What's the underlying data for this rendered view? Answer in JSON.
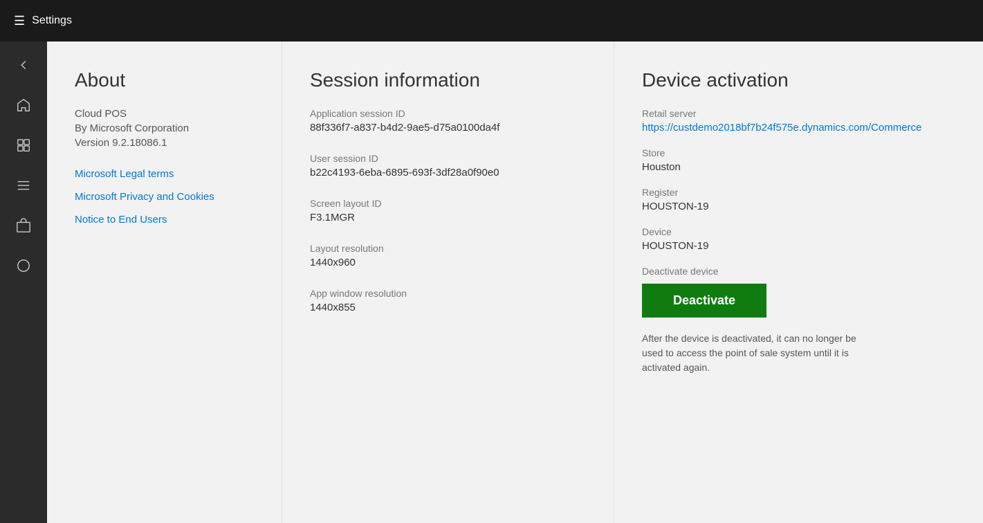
{
  "titlebar": {
    "title": "Settings"
  },
  "sidebar": {
    "items": [
      {
        "name": "back-button",
        "icon": "back"
      },
      {
        "name": "home-button",
        "icon": "home"
      },
      {
        "name": "box-button",
        "icon": "box"
      },
      {
        "name": "menu-button",
        "icon": "menu-lines"
      },
      {
        "name": "bag-button",
        "icon": "bag"
      },
      {
        "name": "circle-button",
        "icon": "circle"
      }
    ]
  },
  "about": {
    "title": "About",
    "app_name": "Cloud POS",
    "company": "By Microsoft Corporation",
    "version": "Version 9.2.18086.1",
    "links": [
      {
        "label": "Microsoft Legal terms"
      },
      {
        "label": "Microsoft Privacy and Cookies"
      },
      {
        "label": "Notice to End Users"
      }
    ]
  },
  "session": {
    "title": "Session information",
    "fields": [
      {
        "label": "Application session ID",
        "value": "88f336f7-a837-b4d2-9ae5-d75a0100da4f"
      },
      {
        "label": "User session ID",
        "value": "b22c4193-6eba-6895-693f-3df28a0f90e0"
      },
      {
        "label": "Screen layout ID",
        "value": "F3.1MGR"
      },
      {
        "label": "Layout resolution",
        "value": "1440x960"
      },
      {
        "label": "App window resolution",
        "value": "1440x855"
      }
    ]
  },
  "device_activation": {
    "title": "Device activation",
    "retail_server_label": "Retail server",
    "retail_server_url": "https://custdemo2018bf7b24f575e.dynamics.com/Commerce",
    "store_label": "Store",
    "store_value": "Houston",
    "register_label": "Register",
    "register_value": "HOUSTON-19",
    "device_label": "Device",
    "device_value": "HOUSTON-19",
    "deactivate_device_label": "Deactivate device",
    "deactivate_button_label": "Deactivate",
    "deactivate_note": "After the device is deactivated, it can no longer be used to access the point of sale system until it is activated again."
  }
}
